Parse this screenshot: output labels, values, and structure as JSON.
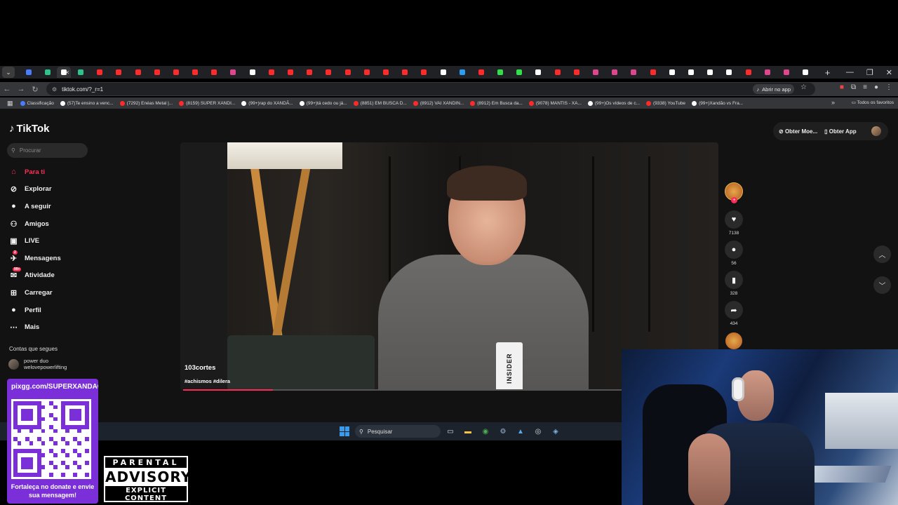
{
  "browser": {
    "tab_favicons": [
      "#4a7cff",
      "#2fc38c",
      "#ffffff",
      "#2fc38c",
      "#ff2a2a",
      "#ff2a2a",
      "#ff2a2a",
      "#ff2a2a",
      "#ff2a2a",
      "#ff2a2a",
      "#ff2a2a",
      "#e0458e",
      "#ffffff",
      "#ff2a2a",
      "#ff2a2a",
      "#ff2a2a",
      "#ff2a2a",
      "#ff2a2a",
      "#ff2a2a",
      "#ff2a2a",
      "#ff2a2a",
      "#ff2a2a",
      "#ffffff",
      "#2a9df4",
      "#ff2a2a",
      "#2fe04a",
      "#2fe04a",
      "#ffffff",
      "#ff2a2a",
      "#ff2a2a",
      "#e0458e",
      "#e0458e",
      "#e0458e",
      "#ff2a2a",
      "#ffffff",
      "#ffffff",
      "#ffffff",
      "#ffffff",
      "#ff2a2a",
      "#e0458e",
      "#e0458e",
      "#ffffff"
    ],
    "active_tab_index": 2,
    "new_tab_label": "+",
    "url": "tiktok.com/?_r=1",
    "open_app_label": "Abrir no app",
    "bookmarks": [
      {
        "label": "Classificação",
        "color": "#4a7cff"
      },
      {
        "label": "(57)Te ensino a venc...",
        "color": "#ffffff"
      },
      {
        "label": "(7292) Enéas Metal |...",
        "color": "#ff2a2a"
      },
      {
        "label": "(8159) SUPER XANDI...",
        "color": "#ff2a2a"
      },
      {
        "label": "(99+)rap do XANDÃ...",
        "color": "#ffffff"
      },
      {
        "label": "(99+)tá cedo ou já...",
        "color": "#ffffff"
      },
      {
        "label": "(8851) EM BUSCA D...",
        "color": "#ff2a2a"
      },
      {
        "label": "(8912) VAI XANDIN...",
        "color": "#ff2a2a"
      },
      {
        "label": "(8912) Em Busca da...",
        "color": "#ff2a2a"
      },
      {
        "label": "(9078) MANTIS - XA...",
        "color": "#ff2a2a"
      },
      {
        "label": "(99+)Os vídeos de c...",
        "color": "#ffffff"
      },
      {
        "label": "(9338) YouTube",
        "color": "#ff2a2a"
      },
      {
        "label": "(99+)Xandão vs Fra...",
        "color": "#ffffff"
      }
    ],
    "all_favorites_label": "Todos os favoritos"
  },
  "tiktok": {
    "logo": "TikTok",
    "search_placeholder": "Procurar",
    "nav": [
      {
        "label": "Para ti",
        "icon": "home-icon",
        "active": true
      },
      {
        "label": "Explorar",
        "icon": "compass-icon"
      },
      {
        "label": "A seguir",
        "icon": "following-avatar-icon"
      },
      {
        "label": "Amigos",
        "icon": "friends-icon"
      },
      {
        "label": "LIVE",
        "icon": "live-icon"
      },
      {
        "label": "Mensagens",
        "icon": "messages-icon",
        "badge": "2"
      },
      {
        "label": "Atividade",
        "icon": "activity-icon",
        "badge": "99+"
      },
      {
        "label": "Carregar",
        "icon": "upload-icon"
      },
      {
        "label": "Perfil",
        "icon": "profile-icon"
      },
      {
        "label": "Mais",
        "icon": "more-icon"
      }
    ],
    "following_heading": "Contas que segues",
    "following_user": {
      "name": "power duo",
      "handle": "welovepowerlifting"
    },
    "get_coins": "Obter Moe...",
    "get_app": "Obter App",
    "video": {
      "author": "103cortes",
      "hashtags": "#achismos #dilera",
      "badge_text": "INSIDER",
      "progress": 0.2
    },
    "actions": {
      "likes": "7138",
      "comments": "56",
      "saves": "328",
      "shares": "434"
    }
  },
  "taskbar": {
    "search_placeholder": "Pesquisar"
  },
  "overlay": {
    "donate_url": "pixgg.com/SUPERXANDAO",
    "donate_caption": "Fortaleça no donate e envie sua mensagem!",
    "advisory_top": "PARENTAL",
    "advisory_mid": "ADVISORY",
    "advisory_bottom": "EXPLICIT CONTENT"
  }
}
